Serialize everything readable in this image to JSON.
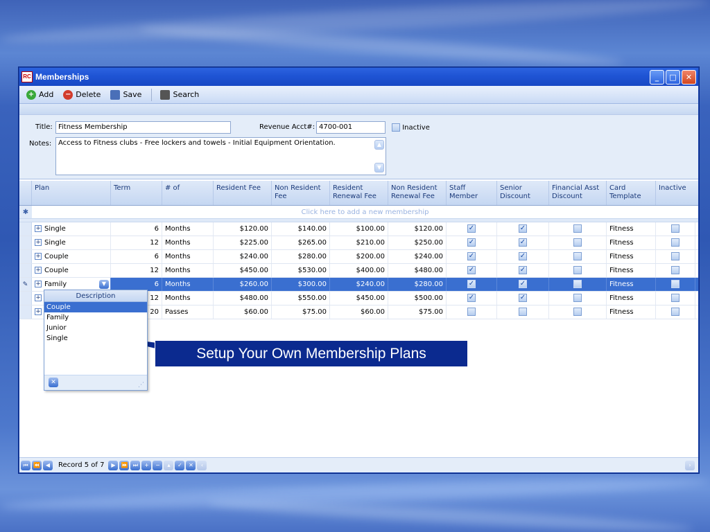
{
  "window": {
    "title": "Memberships",
    "app_icon_text": "RC"
  },
  "toolbar": {
    "add": "Add",
    "delete": "Delete",
    "save": "Save",
    "search": "Search"
  },
  "form": {
    "title_label": "Title:",
    "title_value": "Fitness Membership",
    "revenue_label": "Revenue Acct#:",
    "revenue_value": "4700-001",
    "inactive_label": "Inactive",
    "notes_label": "Notes:",
    "notes_value": "Access to Fitness clubs - Free lockers and towels - Initial Equipment Orientation."
  },
  "grid": {
    "columns": [
      "Plan",
      "Term",
      "# of",
      "Resident Fee",
      "Non Resident Fee",
      "Resident Renewal Fee",
      "Non Resident Renewal Fee",
      "Staff Member",
      "Senior Discount",
      "Financial Asst Discount",
      "Card Template",
      "Inactive"
    ],
    "new_row_hint": "Click here to add a new membership",
    "rows": [
      {
        "plan": "Single",
        "term": "6",
        "unit": "Months",
        "res_fee": "$120.00",
        "nonres_fee": "$140.00",
        "res_renew": "$100.00",
        "nonres_renew": "$120.00",
        "staff": true,
        "senior": true,
        "fin": false,
        "card": "Fitness",
        "inactive": false
      },
      {
        "plan": "Single",
        "term": "12",
        "unit": "Months",
        "res_fee": "$225.00",
        "nonres_fee": "$265.00",
        "res_renew": "$210.00",
        "nonres_renew": "$250.00",
        "staff": true,
        "senior": true,
        "fin": false,
        "card": "Fitness",
        "inactive": false
      },
      {
        "plan": "Couple",
        "term": "6",
        "unit": "Months",
        "res_fee": "$240.00",
        "nonres_fee": "$280.00",
        "res_renew": "$200.00",
        "nonres_renew": "$240.00",
        "staff": true,
        "senior": true,
        "fin": false,
        "card": "Fitness",
        "inactive": false
      },
      {
        "plan": "Couple",
        "term": "12",
        "unit": "Months",
        "res_fee": "$450.00",
        "nonres_fee": "$530.00",
        "res_renew": "$400.00",
        "nonres_renew": "$480.00",
        "staff": true,
        "senior": true,
        "fin": false,
        "card": "Fitness",
        "inactive": false
      },
      {
        "plan": "Family",
        "term": "6",
        "unit": "Months",
        "res_fee": "$260.00",
        "nonres_fee": "$300.00",
        "res_renew": "$240.00",
        "nonres_renew": "$280.00",
        "staff": true,
        "senior": true,
        "fin": false,
        "card": "Fitness",
        "inactive": false,
        "selected": true
      },
      {
        "plan": "",
        "term": "12",
        "unit": "Months",
        "res_fee": "$480.00",
        "nonres_fee": "$550.00",
        "res_renew": "$450.00",
        "nonres_renew": "$500.00",
        "staff": true,
        "senior": true,
        "fin": false,
        "card": "Fitness",
        "inactive": false
      },
      {
        "plan": "",
        "term": "20",
        "unit": "Passes",
        "res_fee": "$60.00",
        "nonres_fee": "$75.00",
        "res_renew": "$60.00",
        "nonres_renew": "$75.00",
        "staff": false,
        "senior": false,
        "fin": false,
        "card": "Fitness",
        "inactive": false
      }
    ]
  },
  "dropdown": {
    "header": "Description",
    "items": [
      "Couple",
      "Family",
      "Junior",
      "Single"
    ],
    "selected": "Couple"
  },
  "callout": {
    "text": "Setup Your Own Membership Plans"
  },
  "navigator": {
    "record_text": "Record 5 of 7"
  }
}
